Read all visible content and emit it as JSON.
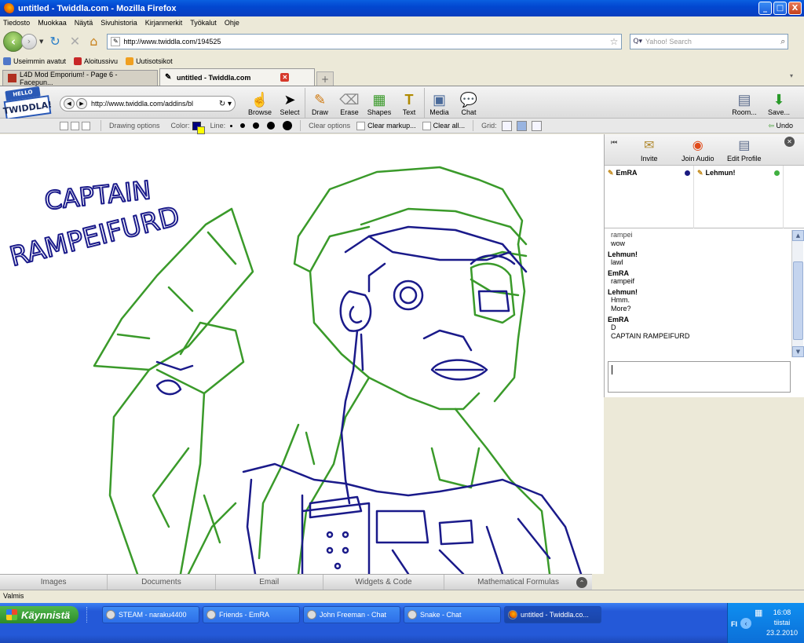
{
  "window": {
    "title": "untitled - Twiddla.com - Mozilla Firefox",
    "controls": [
      "_",
      "□",
      "X"
    ]
  },
  "menu": [
    "Tiedosto",
    "Muokkaa",
    "Näytä",
    "Sivuhistoria",
    "Kirjanmerkit",
    "Työkalut",
    "Ohje"
  ],
  "nav": {
    "url": "http://www.twiddla.com/194525",
    "search_placeholder": "Yahoo! Search"
  },
  "bookmarks": [
    {
      "label": "Useimmin avatut",
      "color": "#5078c8"
    },
    {
      "label": "Aloitussivu",
      "color": "#c82828"
    },
    {
      "label": "Uutisotsikot",
      "color": "#f0a020"
    }
  ],
  "tabs": [
    {
      "label": "L4D Mod Emporium! - Page 6 - Facepun...",
      "active": false
    },
    {
      "label": "untitled - Twiddla.com",
      "active": true
    }
  ],
  "twiddla": {
    "logo_hello": "HELLO",
    "logo_brand": "TWIDDLA!",
    "inner_url": "http://www.twiddla.com/addins/bl",
    "tools": [
      {
        "label": "Browse",
        "icon": "☝"
      },
      {
        "label": "Select",
        "icon": "➤"
      },
      {
        "label": "Draw",
        "icon": "✎"
      },
      {
        "label": "Erase",
        "icon": "⌫"
      },
      {
        "label": "Shapes",
        "icon": "▦"
      },
      {
        "label": "Text",
        "icon": "T"
      },
      {
        "label": "Media",
        "icon": "▣"
      },
      {
        "label": "Chat",
        "icon": "💬"
      }
    ],
    "right_tools": [
      {
        "label": "Room...",
        "icon": "▤"
      },
      {
        "label": "Save...",
        "icon": "⬇"
      }
    ]
  },
  "options": {
    "drawing_options": "Drawing options",
    "color_label": "Color:",
    "line_label": "Line:",
    "clear_options": "Clear options",
    "clear_markup": "Clear markup...",
    "clear_all": "Clear all...",
    "grid_label": "Grid:",
    "undo": "Undo",
    "pen_color": "#000080"
  },
  "bottom_tabs": [
    "Images",
    "Documents",
    "Email",
    "Widgets & Code",
    "Mathematical Formulas"
  ],
  "panel": {
    "buttons": [
      {
        "label": "Invite",
        "icon": "✉"
      },
      {
        "label": "Join Audio",
        "icon": "◉"
      },
      {
        "label": "Edit Profile",
        "icon": "▤"
      }
    ],
    "users": [
      {
        "name": "EmRA",
        "status_color": "#1a1a80"
      },
      {
        "name": "Lehmun!",
        "status_color": "#40b040"
      }
    ],
    "chat": [
      {
        "name": "",
        "lines": [
          "rampei",
          "wow"
        ]
      },
      {
        "name": "Lehmun!",
        "lines": [
          "lawl"
        ]
      },
      {
        "name": "EmRA",
        "lines": [
          "rampeif"
        ]
      },
      {
        "name": "Lehmun!",
        "lines": [
          "Hmm.",
          "More?"
        ]
      },
      {
        "name": "EmRA",
        "lines": [
          "D",
          "CAPTAIN RAMPEIFURD"
        ]
      }
    ]
  },
  "canvas_text": {
    "line1": "CAPTAIN",
    "line2": "RAMPEIFURD"
  },
  "status": "Valmis",
  "taskbar": {
    "start": "Käynnistä",
    "tasks": [
      {
        "label": "STEAM - naraku4400",
        "active": false,
        "ff": false
      },
      {
        "label": "Friends - EmRA",
        "active": false,
        "ff": false
      },
      {
        "label": "John Freeman - Chat",
        "active": false,
        "ff": false
      },
      {
        "label": "Snake - Chat",
        "active": false,
        "ff": false
      },
      {
        "label": "untitled - Twiddla.co...",
        "active": true,
        "ff": true
      }
    ],
    "lang": "FI",
    "time": "16:08",
    "day": "tiistai",
    "date": "23.2.2010"
  }
}
